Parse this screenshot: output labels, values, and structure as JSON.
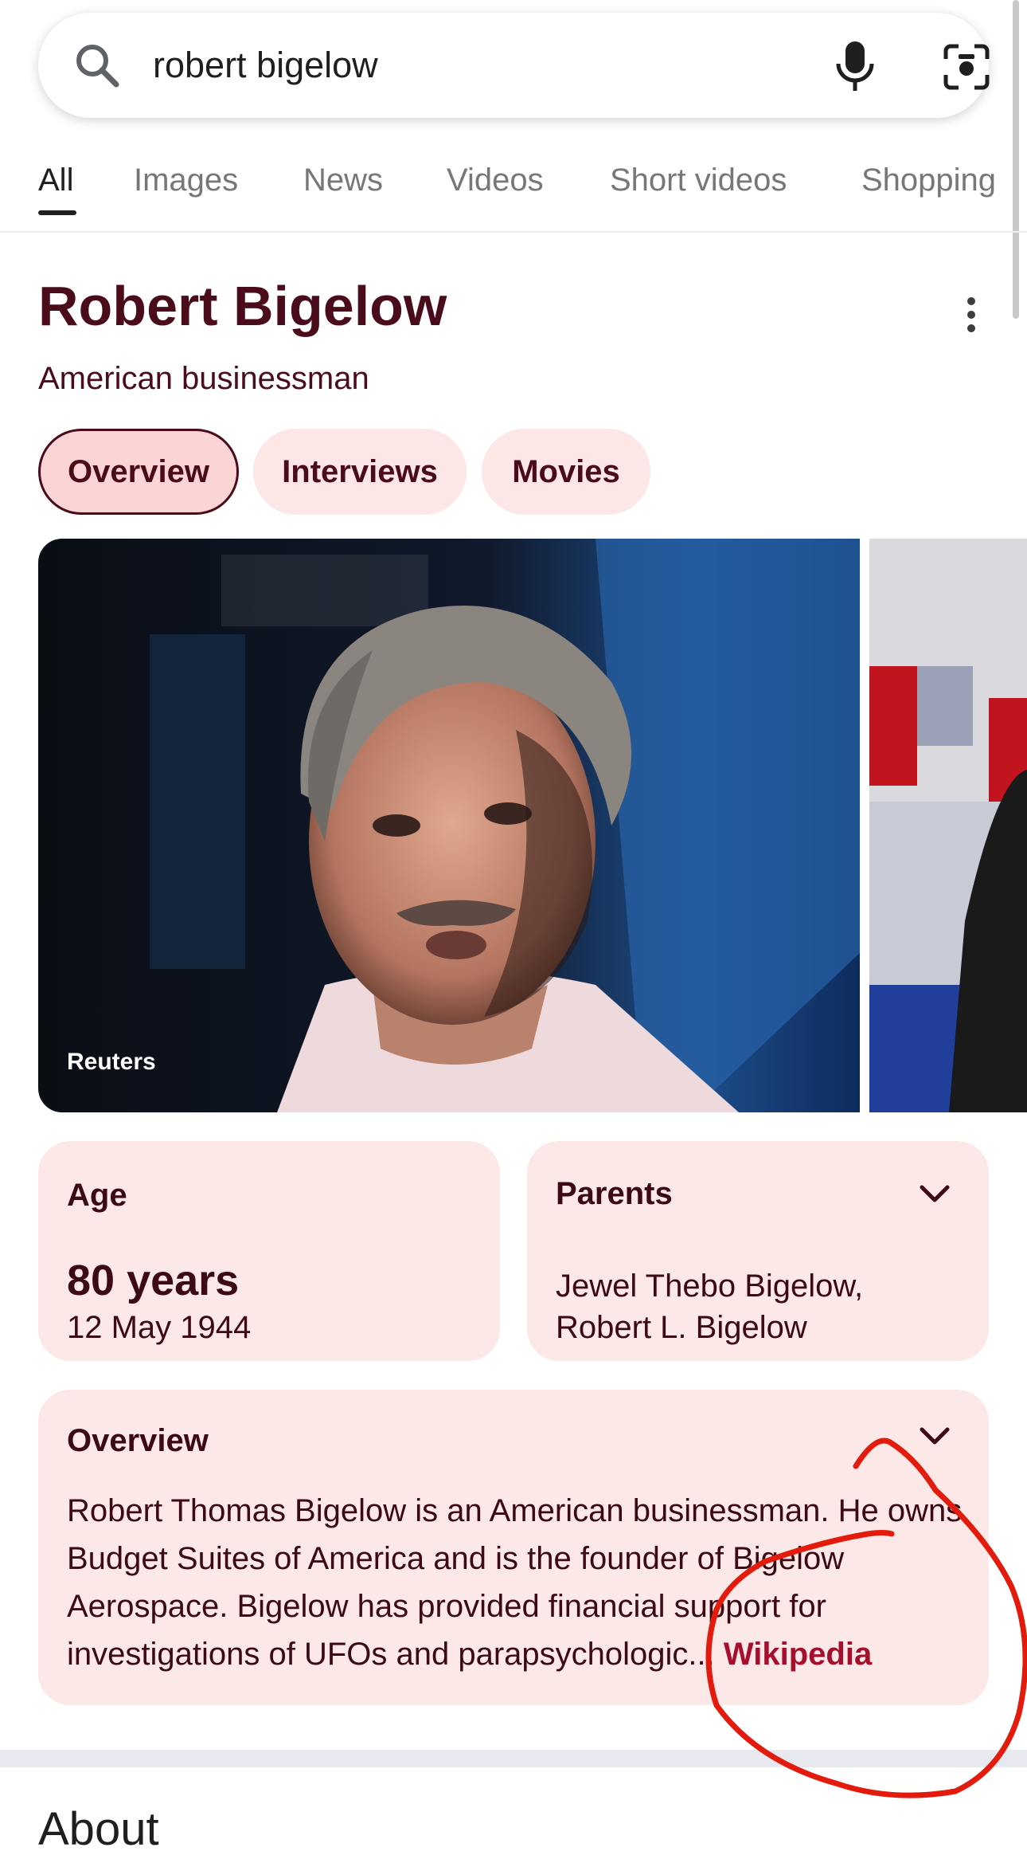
{
  "search": {
    "query": "robert bigelow"
  },
  "tabs": [
    {
      "label": "All"
    },
    {
      "label": "Images"
    },
    {
      "label": "News"
    },
    {
      "label": "Videos"
    },
    {
      "label": "Short videos"
    },
    {
      "label": "Shopping"
    }
  ],
  "entity": {
    "title": "Robert Bigelow",
    "subtitle": "American businessman"
  },
  "chips": [
    {
      "label": "Overview"
    },
    {
      "label": "Interviews"
    },
    {
      "label": "Movies"
    }
  ],
  "image": {
    "caption": "Reuters"
  },
  "age": {
    "label": "Age",
    "value": "80 years",
    "date": "12 May 1944"
  },
  "parents": {
    "label": "Parents",
    "line1": "Jewel Thebo Bigelow,",
    "line2": "Robert L. Bigelow"
  },
  "overview": {
    "label": "Overview",
    "text": "Robert Thomas Bigelow is an American businessman. He owns Budget Suites of America and is the founder of Bigelow Aerospace. Bigelow has provided financial support for investigations of UFOs and parapsychologic...",
    "link": "Wikipedia"
  },
  "about": {
    "heading": "About"
  },
  "colors": {
    "accent": "#4a0c1a",
    "card_bg": "#fde8e8",
    "link": "#a50e2d",
    "annotation": "#e31b0c"
  }
}
